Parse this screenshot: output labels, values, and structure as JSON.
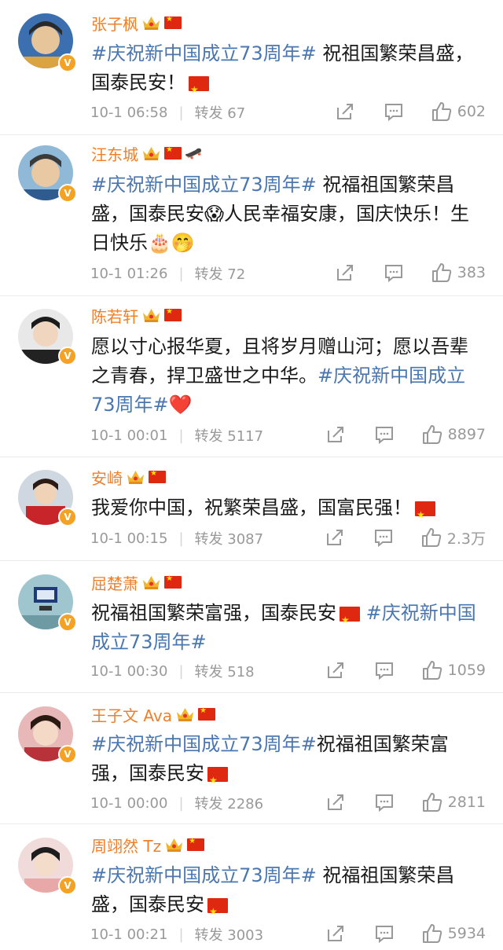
{
  "posts": [
    {
      "name": "张子枫",
      "segments": [
        {
          "t": "tag",
          "v": "#庆祝新中国成立73周年#"
        },
        {
          "t": "text",
          "v": " 祝祖国繁荣昌盛，国泰民安！"
        },
        {
          "t": "flag"
        }
      ],
      "time": "10-1 06:58",
      "repost": "转发 67",
      "likes": "602"
    },
    {
      "name": "汪东城",
      "segments": [
        {
          "t": "tag",
          "v": "#庆祝新中国成立73周年#"
        },
        {
          "t": "text",
          "v": " 祝福祖国繁荣昌盛，国泰民安"
        },
        {
          "t": "emoji",
          "v": "😱"
        },
        {
          "t": "text",
          "v": "人民幸福安康，国庆快乐！生日快乐"
        },
        {
          "t": "emoji",
          "v": "🎂"
        },
        {
          "t": "emoji",
          "v": "🤭"
        }
      ],
      "time": "10-1 01:26",
      "repost": "转发 72",
      "likes": "383"
    },
    {
      "name": "陈若轩",
      "segments": [
        {
          "t": "text",
          "v": "愿以寸心报华夏，且将岁月赠山河；愿以吾辈之青春，捍卫盛世之中华。"
        },
        {
          "t": "tag",
          "v": "#庆祝新中国成立73周年#"
        },
        {
          "t": "emoji",
          "v": "❤️"
        }
      ],
      "time": "10-1 00:01",
      "repost": "转发 5117",
      "likes": "8897"
    },
    {
      "name": "安崎",
      "segments": [
        {
          "t": "text",
          "v": "我爱你中国，祝繁荣昌盛，国富民强！"
        },
        {
          "t": "flag"
        }
      ],
      "time": "10-1 00:15",
      "repost": "转发 3087",
      "likes": "2.3万"
    },
    {
      "name": "屈楚萧",
      "segments": [
        {
          "t": "text",
          "v": "祝福祖国繁荣富强，国泰民安"
        },
        {
          "t": "flag"
        },
        {
          "t": "text",
          "v": " "
        },
        {
          "t": "tag",
          "v": "#庆祝新中国成立73周年#"
        }
      ],
      "time": "10-1 00:30",
      "repost": "转发 518",
      "likes": "1059"
    },
    {
      "name": "王子文 Ava",
      "segments": [
        {
          "t": "tag",
          "v": "#庆祝新中国成立73周年#"
        },
        {
          "t": "text",
          "v": "祝福祖国繁荣富强，国泰民安"
        },
        {
          "t": "flag"
        }
      ],
      "time": "10-1 00:00",
      "repost": "转发 2286",
      "likes": "2811"
    },
    {
      "name": "周翊然 Tz",
      "segments": [
        {
          "t": "tag",
          "v": "#庆祝新中国成立73周年#"
        },
        {
          "t": "text",
          "v": " 祝福祖国繁荣昌盛，国泰民安"
        },
        {
          "t": "flag"
        }
      ],
      "time": "10-1 00:21",
      "repost": "转发 3003",
      "likes": "5934"
    }
  ],
  "avatar_badge": "V",
  "icons": {
    "crown": "crown-badge-icon",
    "flag": "china-flag-icon",
    "skate": "skateboard-icon",
    "share": "share-icon",
    "comment": "comment-icon",
    "like": "thumbs-up-icon"
  },
  "colors": {
    "name": "#f07f2b",
    "tag": "#4a77b0",
    "meta": "#999999",
    "flag": "#de2910",
    "badge": "#f4a223"
  }
}
